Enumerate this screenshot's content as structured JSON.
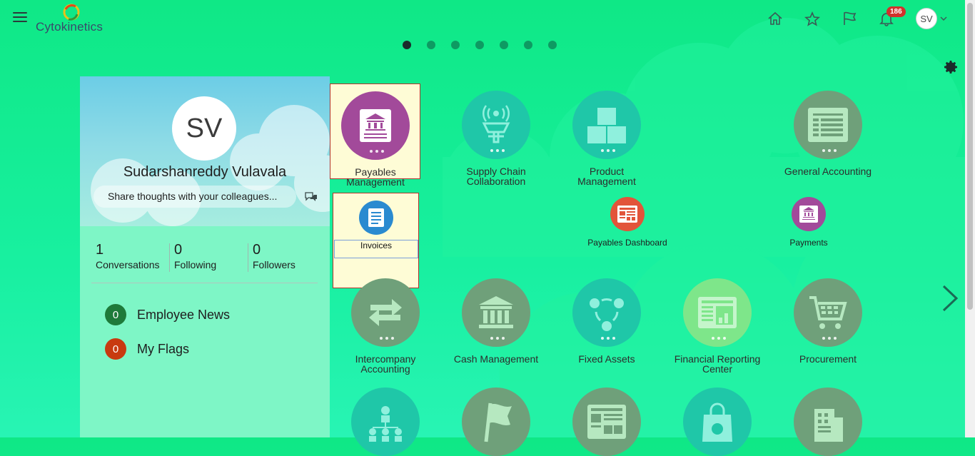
{
  "header": {
    "logo_text": "Cytokinetics",
    "notifications_count": "186",
    "user_initials": "SV"
  },
  "pagination": {
    "pages": 7,
    "active": 1
  },
  "profile": {
    "initials": "SV",
    "name": "Sudarshanreddy Vulavala",
    "share_placeholder": "Share thoughts with your colleagues...",
    "stats": [
      {
        "value": "1",
        "label": "Conversations"
      },
      {
        "value": "0",
        "label": "Following"
      },
      {
        "value": "0",
        "label": "Followers"
      }
    ],
    "news": [
      {
        "count": "0",
        "label": "Employee News",
        "color": "#1e7a3a"
      },
      {
        "count": "0",
        "label": "My Flags",
        "color": "#c83a10"
      }
    ]
  },
  "apps": {
    "payables": "Payables Management",
    "invoices": "Invoices",
    "supply_chain_1": "Supply Chain",
    "supply_chain_2": "Collaboration",
    "product_1": "Product",
    "product_2": "Management",
    "general_accounting": "General Accounting",
    "payables_dashboard": "Payables Dashboard",
    "payments": "Payments",
    "intercompany_1": "Intercompany",
    "intercompany_2": "Accounting",
    "cash_management": "Cash Management",
    "fixed_assets": "Fixed Assets",
    "financial_reporting_1": "Financial Reporting",
    "financial_reporting_2": "Center",
    "procurement": "Procurement"
  },
  "colors": {
    "payables": "#a24a9a",
    "invoices": "#2a8ad0",
    "teal": "#1fc7a8",
    "olive": "#6fa07a",
    "dashboard": "#e2543a",
    "payments": "#a24a9a"
  }
}
